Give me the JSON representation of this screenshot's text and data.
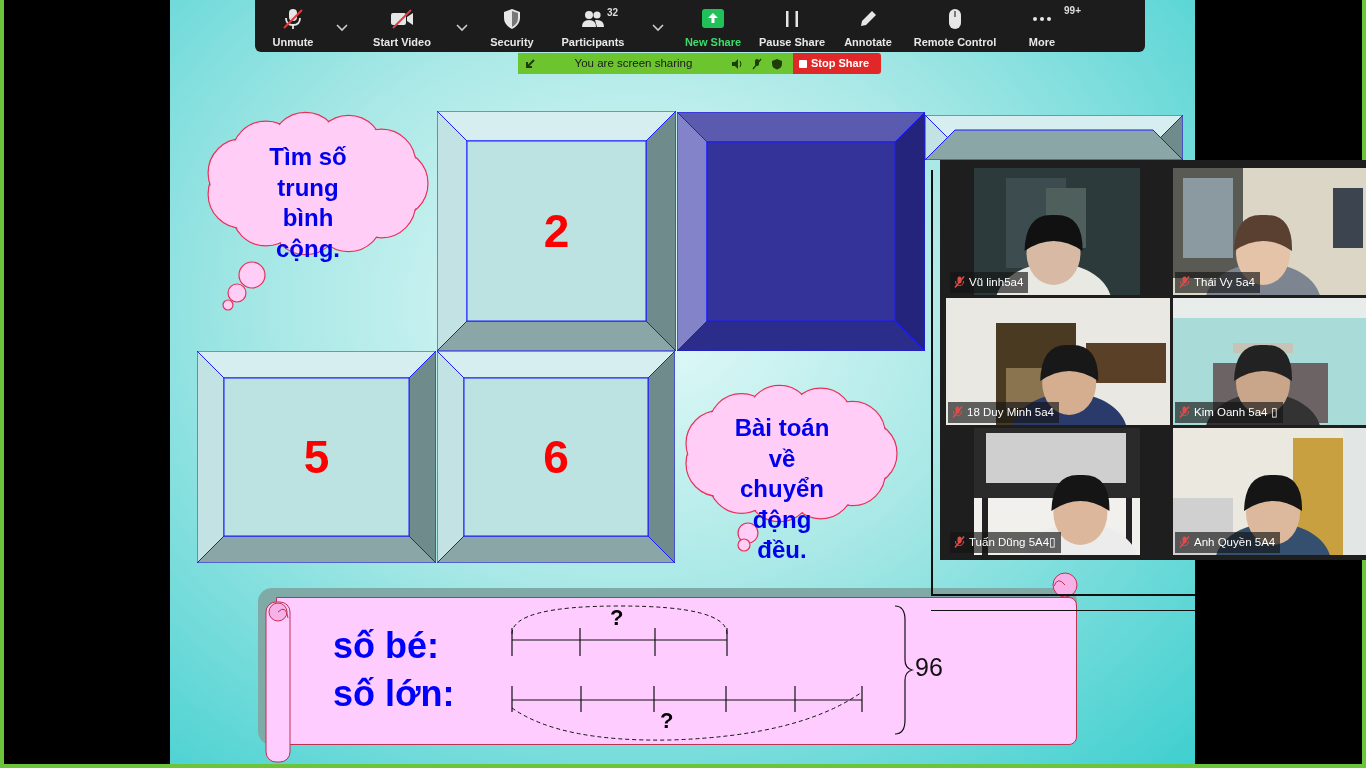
{
  "toolbar": {
    "buttons": [
      {
        "kind": "mic",
        "label": "Unmute",
        "off": true,
        "menu": true,
        "accent": false
      },
      {
        "kind": "video",
        "label": "Start Video",
        "off": true,
        "menu": true,
        "accent": false
      },
      {
        "kind": "security",
        "label": "Security",
        "off": false,
        "menu": false,
        "accent": false
      },
      {
        "kind": "participants",
        "label": "Participants",
        "badge": "32",
        "off": false,
        "menu": true,
        "accent": false
      },
      {
        "kind": "share",
        "label": "New Share",
        "off": false,
        "menu": false,
        "accent": true
      },
      {
        "kind": "pause",
        "label": "Pause Share",
        "off": false,
        "menu": false,
        "accent": false
      },
      {
        "kind": "annotate",
        "label": "Annotate",
        "off": false,
        "menu": false,
        "accent": false
      },
      {
        "kind": "remote",
        "label": "Remote Control",
        "off": false,
        "menu": false,
        "accent": false
      },
      {
        "kind": "more",
        "label": "More",
        "badge": "99+",
        "off": false,
        "menu": false,
        "accent": false
      }
    ]
  },
  "sharing_bar": {
    "status": "You are screen sharing",
    "stop_label": "Stop Share"
  },
  "slide": {
    "clouds": [
      {
        "text": "Tìm số trung bình cộng."
      },
      {
        "text": "Bài toán về chuyển động đều."
      }
    ],
    "tiles": [
      {
        "number": "2",
        "selected": false
      },
      {
        "selected": true
      },
      {
        "selected": false
      },
      {
        "number": "5",
        "selected": false
      },
      {
        "number": "6",
        "selected": false
      }
    ],
    "banner": {
      "rows": [
        {
          "label": "số bé:",
          "question": "?"
        },
        {
          "label": "số lớn:",
          "question": "?"
        }
      ],
      "total": "96"
    }
  },
  "gallery": {
    "participants": [
      {
        "name": "Vũ linh5a4",
        "muted": true
      },
      {
        "name": "Thái Vy 5a4",
        "muted": true
      },
      {
        "name": "18 Duy Minh 5a4",
        "muted": true
      },
      {
        "name": "Kim Oanh 5a4 ▯",
        "muted": true
      },
      {
        "name": "Tuấn Dũng 5A4▯",
        "muted": true
      },
      {
        "name": "Anh Quyền 5A4",
        "muted": true
      }
    ]
  }
}
